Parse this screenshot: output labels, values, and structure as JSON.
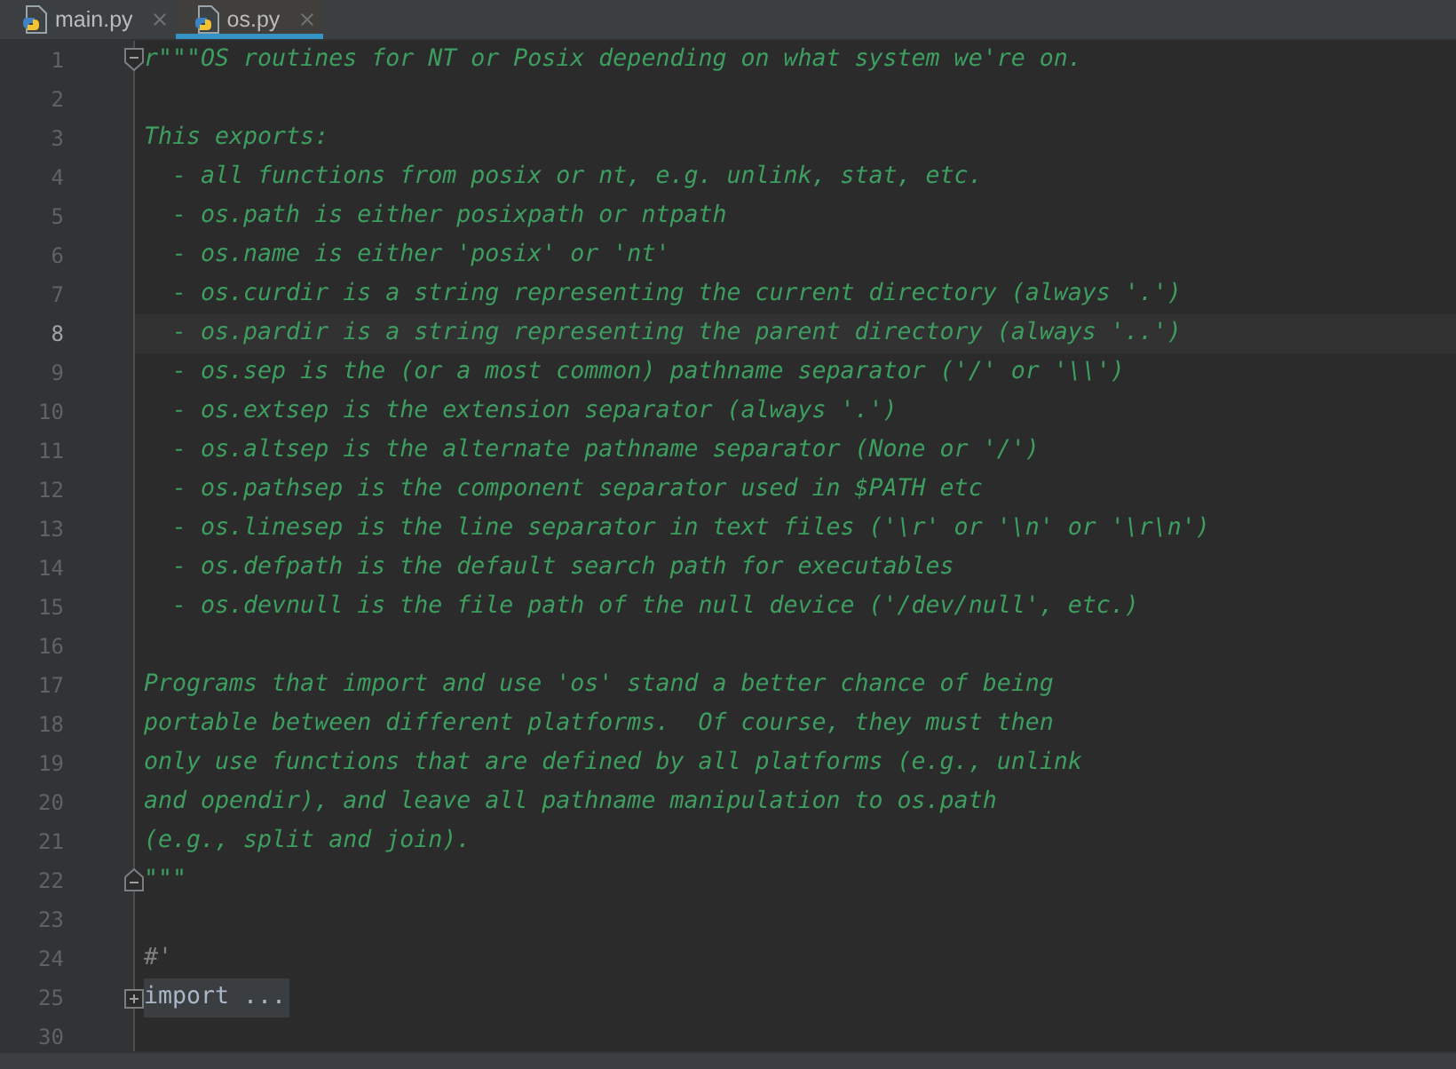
{
  "tabs": [
    {
      "label": "main.py",
      "selected": false
    },
    {
      "label": "os.py",
      "selected": true
    }
  ],
  "editor": {
    "lines": [
      {
        "number": "1",
        "kind": "docstring",
        "text": "r\"\"\"OS routines for NT or Posix depending on what system we're on.",
        "fold_marker": {
          "kind": "start"
        },
        "current": false
      },
      {
        "number": "2",
        "kind": "blank",
        "current": false
      },
      {
        "number": "3",
        "kind": "docstring",
        "text": "This exports:",
        "current": false
      },
      {
        "number": "4",
        "kind": "docstring",
        "text": "  - all functions from posix or nt, e.g. unlink, stat, etc.",
        "current": false
      },
      {
        "number": "5",
        "kind": "docstring",
        "text": "  - os.path is either posixpath or ntpath",
        "current": false
      },
      {
        "number": "6",
        "kind": "docstring",
        "text": "  - os.name is either 'posix' or 'nt'",
        "current": false
      },
      {
        "number": "7",
        "kind": "docstring",
        "text": "  - os.curdir is a string representing the current directory (always '.')",
        "current": false
      },
      {
        "number": "8",
        "kind": "docstring",
        "text": "  - os.pardir is a string representing the parent directory (always '..')",
        "current": true
      },
      {
        "number": "9",
        "kind": "docstring",
        "text": "  - os.sep is the (or a most common) pathname separator ('/' or '\\\\')",
        "current": false
      },
      {
        "number": "10",
        "kind": "docstring",
        "text": "  - os.extsep is the extension separator (always '.')",
        "current": false
      },
      {
        "number": "11",
        "kind": "docstring",
        "text": "  - os.altsep is the alternate pathname separator (None or '/')",
        "current": false
      },
      {
        "number": "12",
        "kind": "docstring",
        "text": "  - os.pathsep is the component separator used in $PATH etc",
        "current": false
      },
      {
        "number": "13",
        "kind": "docstring",
        "text": "  - os.linesep is the line separator in text files ('\\r' or '\\n' or '\\r\\n')",
        "current": false
      },
      {
        "number": "14",
        "kind": "docstring",
        "text": "  - os.defpath is the default search path for executables",
        "current": false
      },
      {
        "number": "15",
        "kind": "docstring",
        "text": "  - os.devnull is the file path of the null device ('/dev/null', etc.)",
        "current": false
      },
      {
        "number": "16",
        "kind": "blank",
        "current": false
      },
      {
        "number": "17",
        "kind": "docstring",
        "text": "Programs that import and use 'os' stand a better chance of being",
        "current": false
      },
      {
        "number": "18",
        "kind": "docstring",
        "text": "portable between different platforms.  Of course, they must then",
        "current": false
      },
      {
        "number": "19",
        "kind": "docstring",
        "text": "only use functions that are defined by all platforms (e.g., unlink",
        "current": false
      },
      {
        "number": "20",
        "kind": "docstring",
        "text": "and opendir), and leave all pathname manipulation to os.path",
        "current": false
      },
      {
        "number": "21",
        "kind": "docstring",
        "text": "(e.g., split and join).",
        "current": false
      },
      {
        "number": "22",
        "kind": "docstring",
        "text": "\"\"\"",
        "fold_marker": {
          "kind": "end"
        },
        "current": false
      },
      {
        "number": "23",
        "kind": "blank",
        "current": false
      },
      {
        "number": "24",
        "kind": "comment",
        "text": "#'",
        "current": false
      },
      {
        "number": "25",
        "kind": "folded",
        "text": "import ...",
        "fold_marker": {
          "kind": "collapsed"
        },
        "current": false
      },
      {
        "number": "30",
        "kind": "blank",
        "current": false
      }
    ]
  }
}
